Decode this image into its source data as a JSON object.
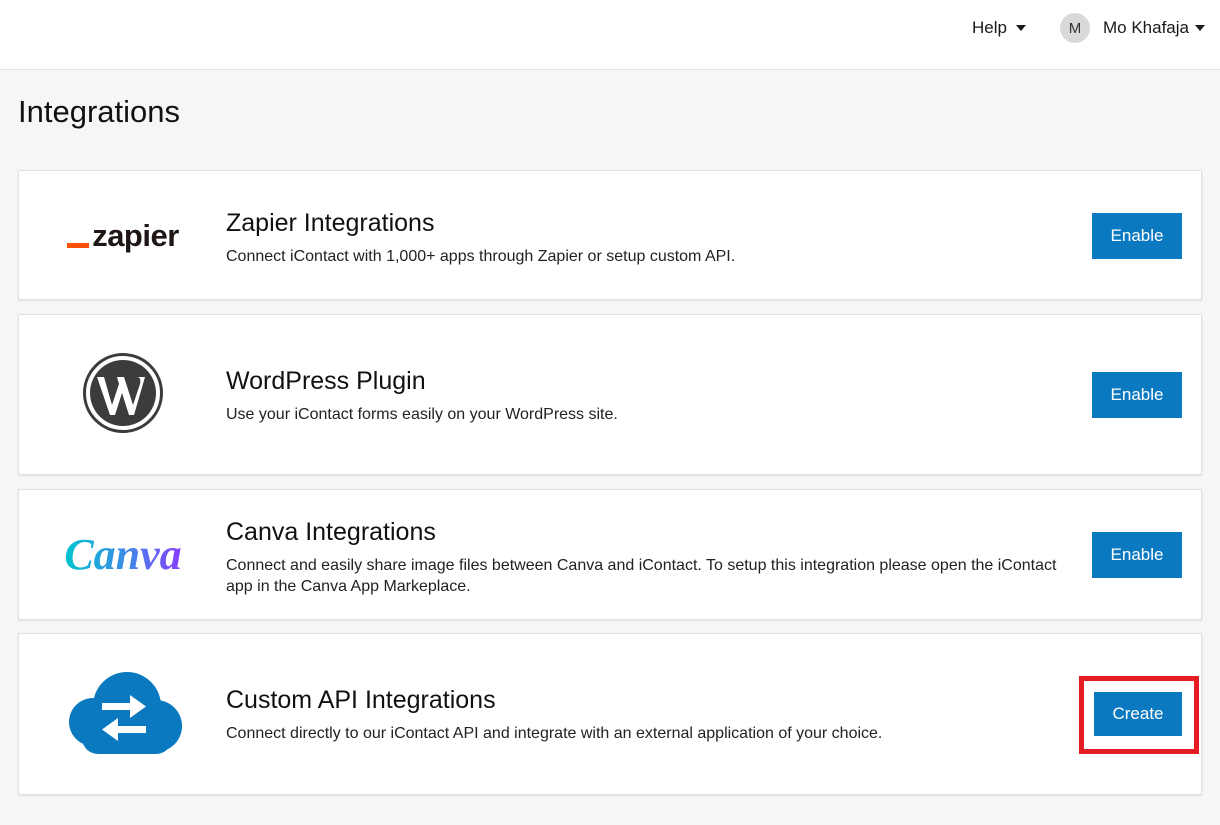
{
  "header": {
    "help_label": "Help",
    "user": {
      "avatar_initial": "M",
      "name": "Mo Khafaja"
    }
  },
  "page": {
    "title": "Integrations"
  },
  "integrations": [
    {
      "logo": "zapier-logo",
      "logo_text": "zapier",
      "title": "Zapier Integrations",
      "description": "Connect iContact with 1,000+ apps through Zapier or setup custom API.",
      "button_label": "Enable"
    },
    {
      "logo": "wordpress-logo",
      "title": "WordPress Plugin",
      "description": "Use your iContact forms easily on your WordPress site.",
      "button_label": "Enable"
    },
    {
      "logo": "canva-logo",
      "logo_text": "Canva",
      "title": "Canva Integrations",
      "description": "Connect and easily share image files between Canva and iContact. To setup this integration please open the iContact app in the Canva App Markeplace.",
      "button_label": "Enable"
    },
    {
      "logo": "cloud-sync-icon",
      "title": "Custom API Integrations",
      "description": "Connect directly to our iContact API and integrate with an external application of your choice.",
      "button_label": "Create"
    }
  ],
  "colors": {
    "button": "#0b79c0",
    "highlight": "#e41c24",
    "zapier_orange": "#ff4f00",
    "cloud_blue": "#0b79c0"
  }
}
